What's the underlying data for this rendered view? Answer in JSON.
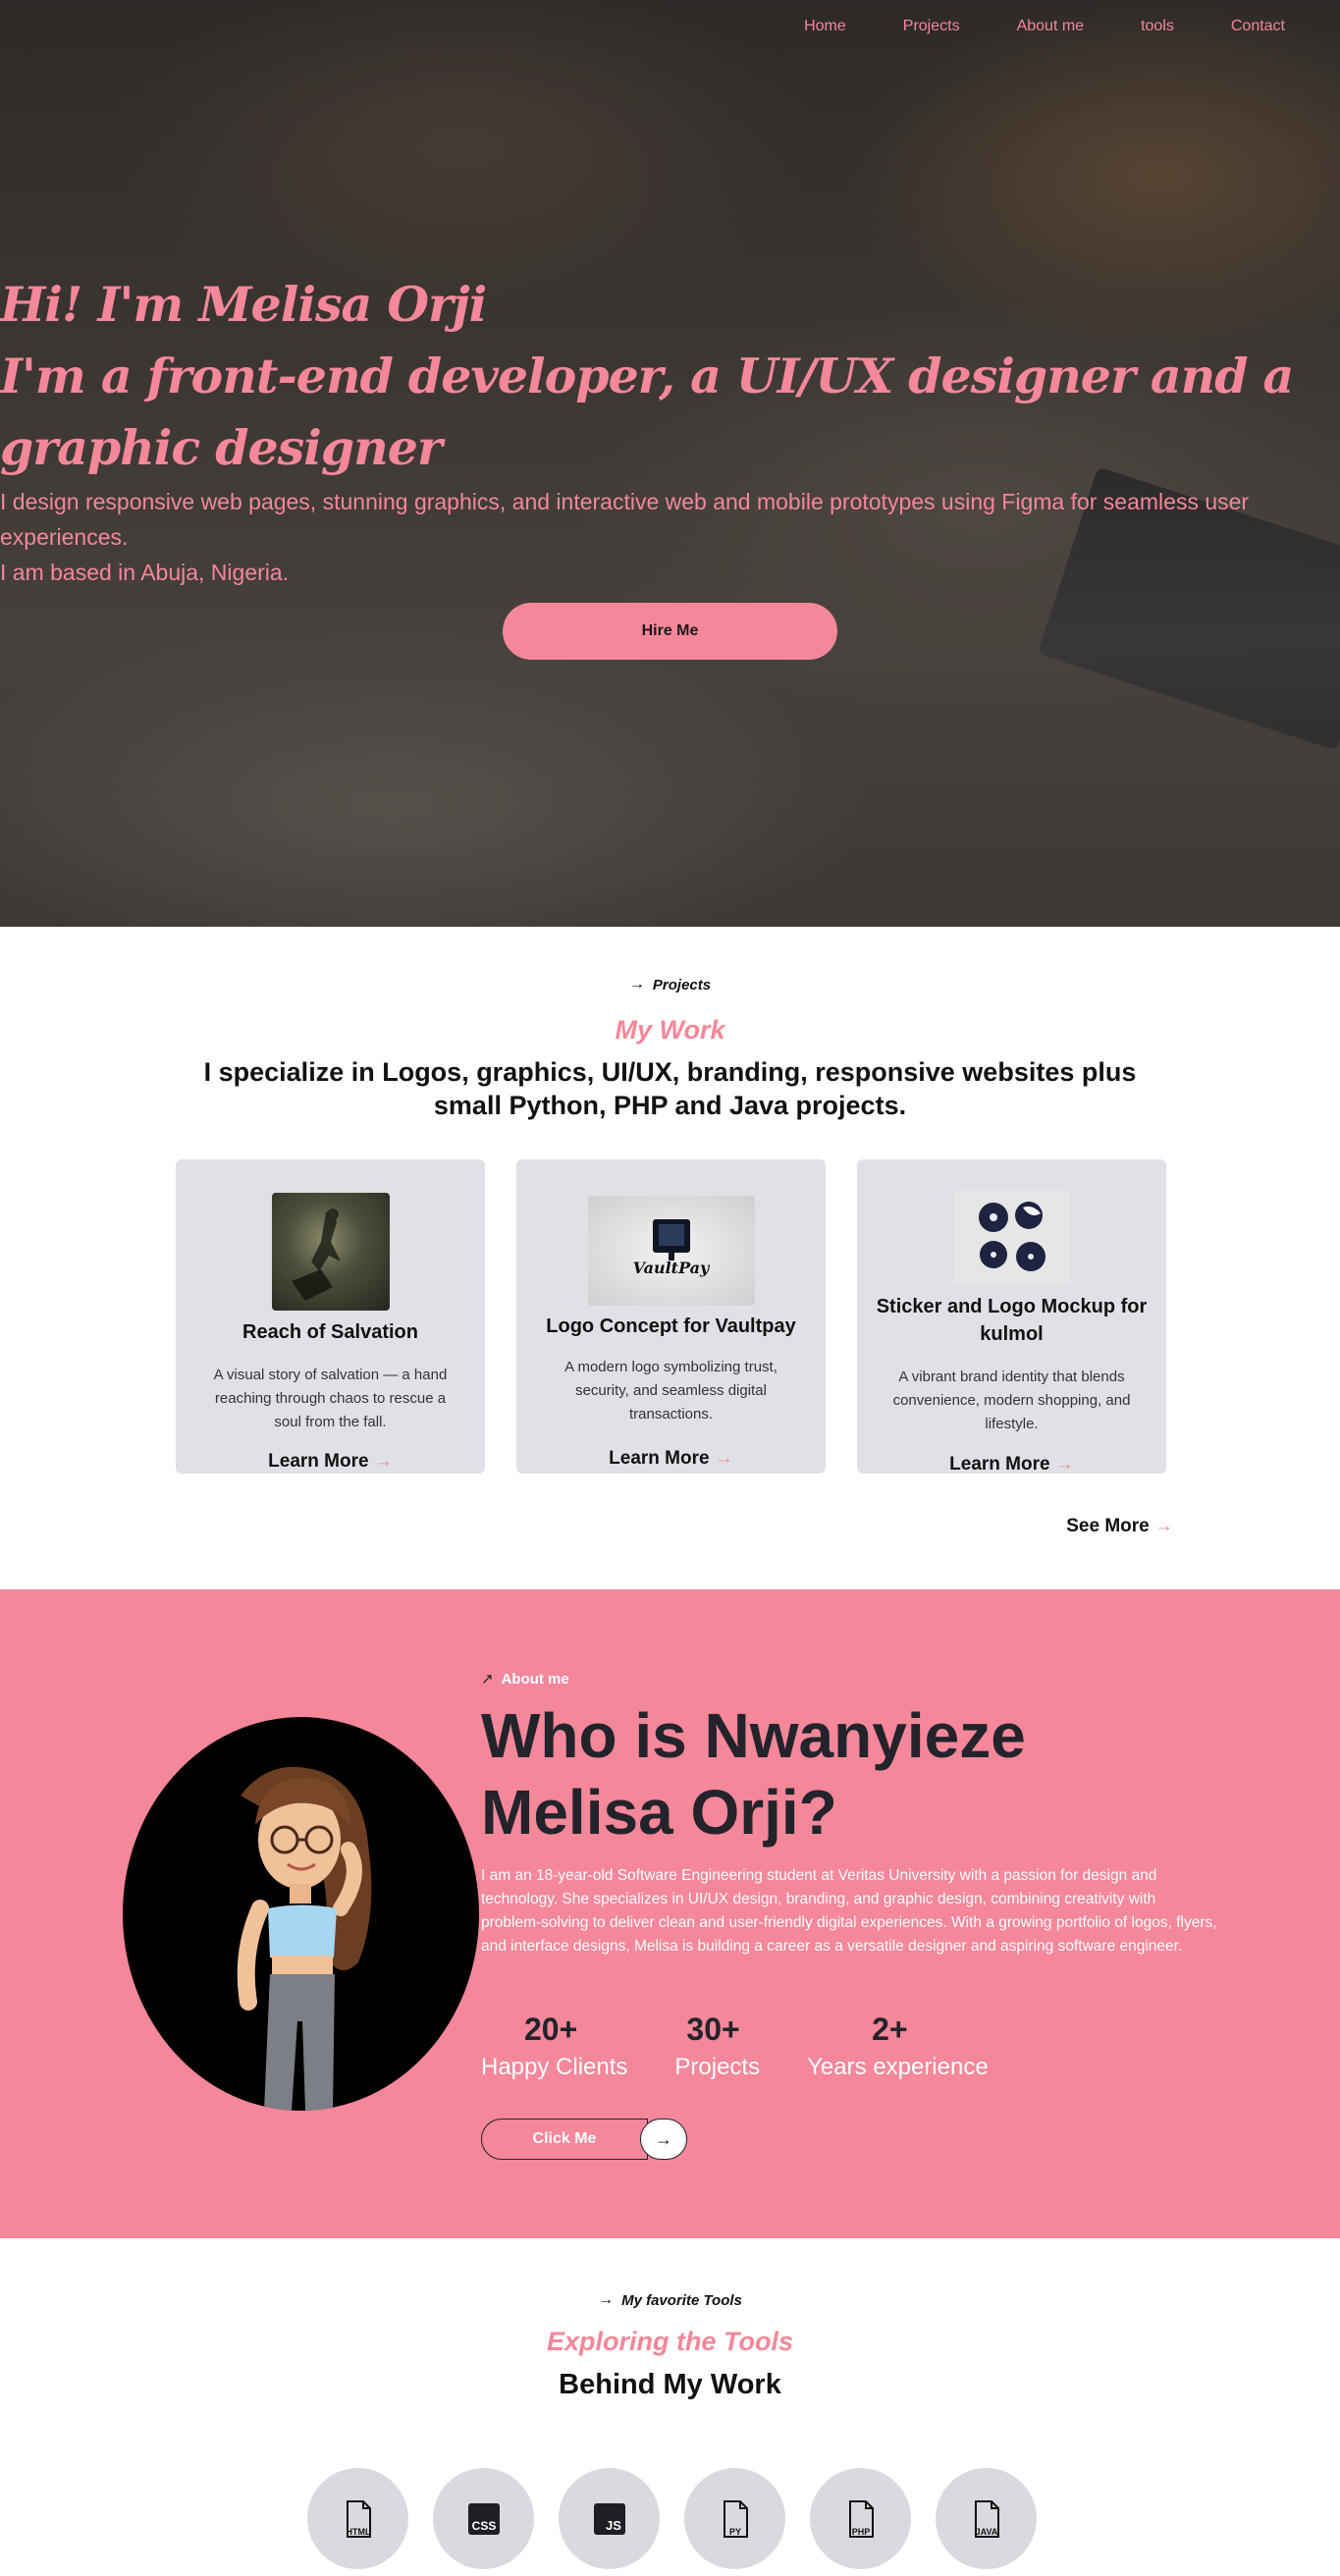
{
  "nav": {
    "items": [
      "Home",
      "Projects",
      "About me",
      "tools",
      "Contact"
    ]
  },
  "hero": {
    "title_line1": "Hi! I'm Melisa Orji",
    "title_line2": "I'm a front-end developer, a UI/UX designer and a graphic designer",
    "description": "I design responsive web pages, stunning graphics, and interactive web and mobile prototypes using Figma for seamless user experiences.",
    "location": "I am based in Abuja, Nigeria.",
    "cta": "Hire Me"
  },
  "projects": {
    "eyebrow": "Projects",
    "subtitle": "My Work",
    "lead": "I specialize in Logos, graphics, UI/UX, branding, responsive websites plus small Python, PHP and Java projects.",
    "cards": [
      {
        "title": "Reach of Salvation",
        "description": "A visual story of salvation — a hand reaching through chaos to rescue a soul from the fall.",
        "link": "Learn More"
      },
      {
        "title": "Logo Concept for Vaultpay",
        "description": "A modern logo symbolizing trust, security, and seamless digital transactions.",
        "link": "Learn More",
        "image_text": "VaultPay"
      },
      {
        "title": "Sticker and Logo Mockup for kulmol",
        "description": "A vibrant brand identity that blends convenience, modern shopping, and lifestyle.",
        "link": "Learn More"
      }
    ],
    "see_more": "See More"
  },
  "about": {
    "eyebrow": "About me",
    "title": "Who is Nwanyieze Melisa Orji?",
    "text": "I am an 18-year-old Software Engineering student at Veritas University with a passion for design and technology. She specializes in UI/UX design, branding, and graphic design, combining creativity with problem-solving to deliver clean and user-friendly digital experiences. With a growing portfolio of logos, flyers, and interface designs, Melisa is building a career as a versatile designer and aspiring software engineer.",
    "stats": [
      {
        "value": "20+",
        "label": "Happy Clients"
      },
      {
        "value": "30+",
        "label": "Projects"
      },
      {
        "value": "2+",
        "label": "Years experience"
      }
    ],
    "cta": "Click Me"
  },
  "tools": {
    "eyebrow": "My favorite Tools",
    "subtitle": "Exploring the Tools",
    "lead": "Behind My Work",
    "items": [
      {
        "label": "HTML",
        "icon": "html-file-icon"
      },
      {
        "label": "CSS",
        "icon": "css-icon"
      },
      {
        "label": "JS",
        "icon": "js-icon"
      },
      {
        "label": "PY",
        "icon": "python-file-icon"
      },
      {
        "label": "PHP",
        "icon": "php-file-icon"
      },
      {
        "label": "JAVA",
        "icon": "java-file-icon"
      }
    ]
  },
  "colors": {
    "accent": "#f4879a",
    "dark": "#23232b",
    "card_bg": "#dfe1e6",
    "tool_bg": "#d9dadf"
  }
}
